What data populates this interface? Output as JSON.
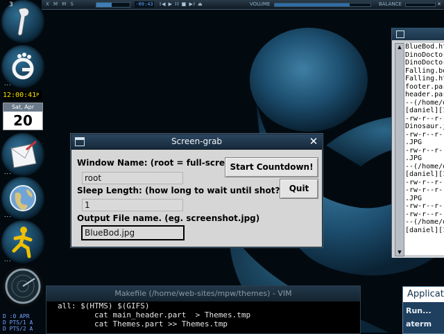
{
  "xmms": {
    "logo": "X M M S",
    "time": "-00:43",
    "controls": "I◀ ▶ II ■ ▶I ⏏",
    "volume_label": "VOLUME",
    "volume_level": 0.78,
    "balance_label": "BALANCE",
    "position_level": 0.45,
    "close": "✕"
  },
  "dock": {
    "desktop_number": "3",
    "clock": "12:00:41",
    "clock_suffix": "P",
    "calendar_day_label": "Sat, Apr",
    "calendar_day": "20",
    "pts_lines": [
      "D :0 APR",
      "D PTS/1 A",
      "D PTS/2 A"
    ],
    "dots": "..."
  },
  "right_terminal": {
    "lines": [
      "BlueBod.ht",
      "DinoDoctor",
      "DinoDoctor",
      "Falling.bo",
      "Falling.ht",
      "footer.par",
      "header.par",
      "--(/home/d",
      "[daniel][1",
      "-rw-r--r--",
      "Dinosaur.j",
      "-rw-r--r--",
      ".JPG",
      "-rw-r--r--",
      ".JPG",
      "--(/home/d",
      "[daniel][1",
      "-rw-r--r--",
      "-rw-r--r--",
      ".JPG",
      "-rw-r--r--",
      "-rw-r--r--",
      "--(/home/d",
      "[daniel][1"
    ],
    "scroll_up": "▲",
    "scroll_down": "▼"
  },
  "vim": {
    "title": "Makefile (/home/web-sites/mpw/themes) - VIM",
    "lines": [
      "all: $(HTMS) $(GIFS)",
      "        cat main_header.part  > Themes.tmp",
      "        cat Themes.part >> Themes.tmp"
    ]
  },
  "app_menu": {
    "title": "Applications",
    "items": [
      "Run...",
      "aterm"
    ]
  },
  "dialog": {
    "title": "Screen-grab",
    "close_glyph": "✕",
    "window_name_label": "Window Name: (root = full-screen)",
    "window_name_value": "root",
    "sleep_label": "Sleep Length: (how long to wait until shot?)",
    "sleep_value": "1",
    "output_label": "Output File name. (eg. screenshot.jpg)",
    "output_value": "BlueBod.jpg",
    "start_button": "Start Countdown!",
    "quit_button": "Quit"
  },
  "colors": {
    "desktop_bg": "#020a10",
    "dock_blue": "#2f6f95",
    "dialog_bg": "#d6d6d6",
    "clock_yellow": "#f3e600"
  }
}
